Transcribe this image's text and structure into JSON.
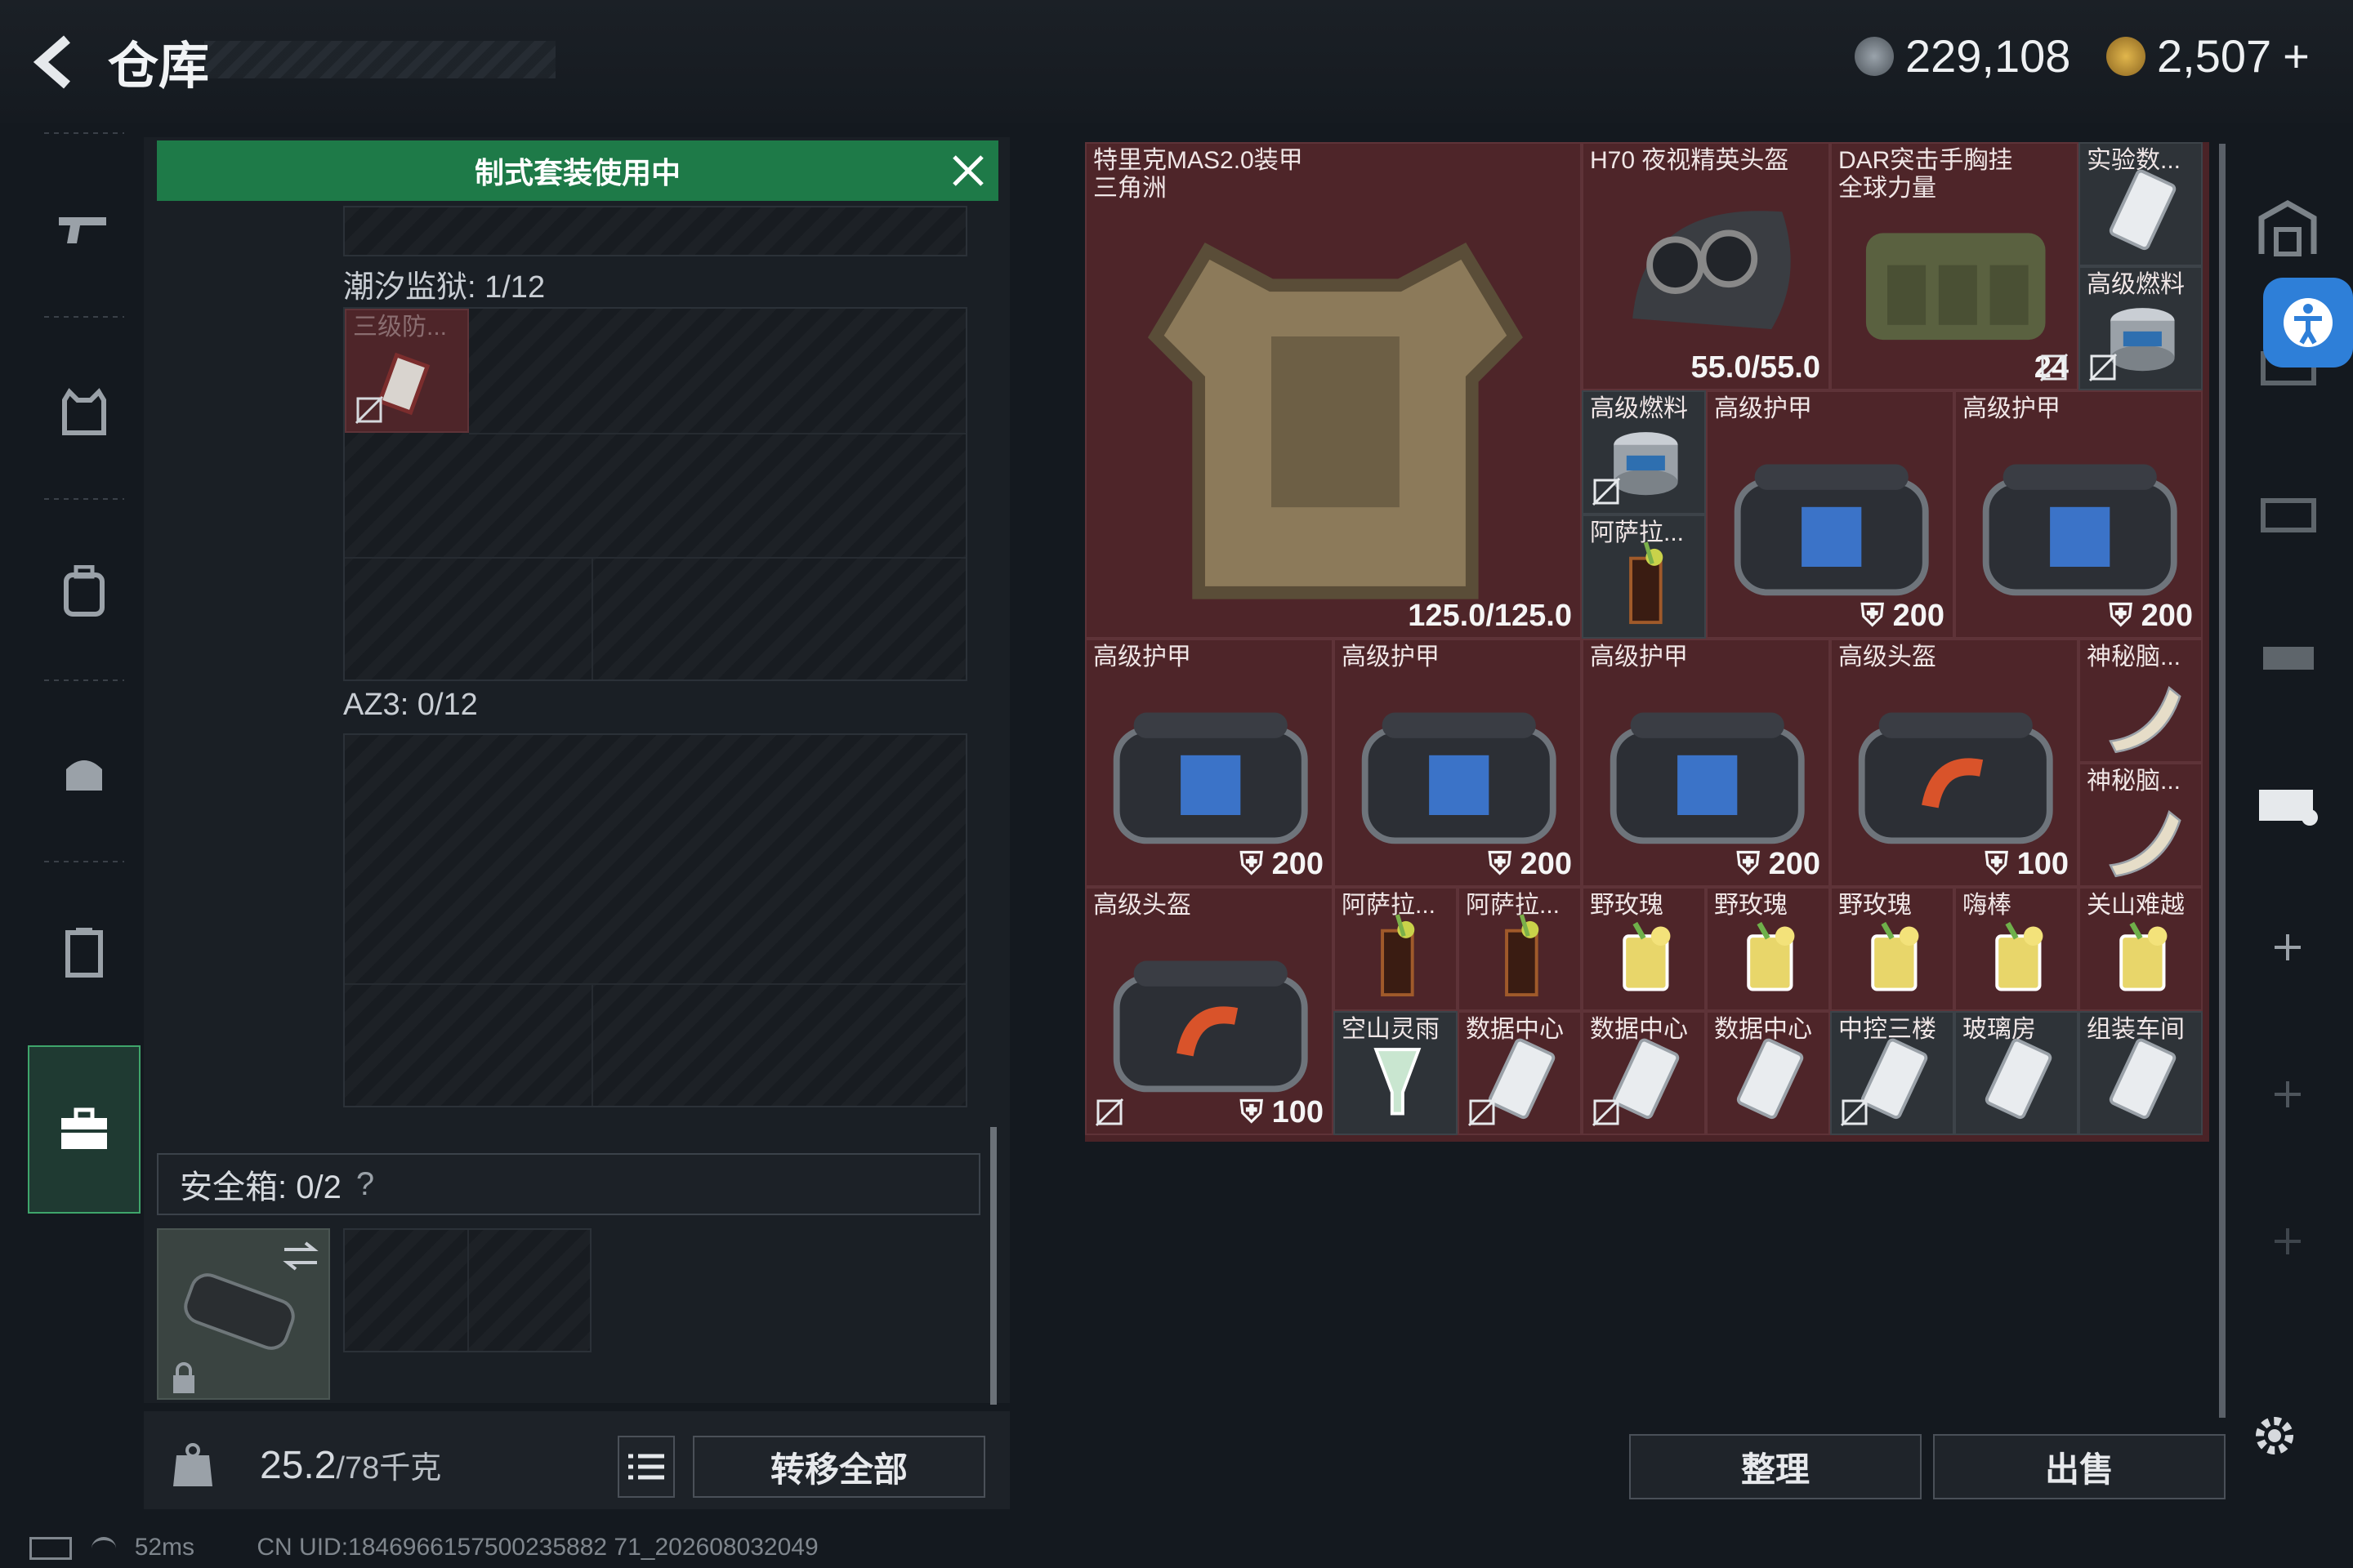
{
  "header": {
    "title": "仓库",
    "currency1": "229,108",
    "currency2": "2,507",
    "currency2_plus": "+"
  },
  "kit_banner": "制式套装使用中",
  "containers": [
    {
      "label": "潮汐监狱: 1/12",
      "item_name": "三级防..."
    },
    {
      "label": "AZ3: 0/12"
    }
  ],
  "safebox": {
    "label": "安全箱: 0/2",
    "help": "?"
  },
  "weight": {
    "current": "25.2",
    "max": "/78千克"
  },
  "buttons": {
    "transfer_all": "转移全部",
    "sort": "整理",
    "sell": "出售"
  },
  "status": {
    "ping": "52ms",
    "uid": "CN UID:1846966157500235882 71_202608032049"
  },
  "stash_items": [
    {
      "id": "vest",
      "name": "特里克MAS2.0装甲\n三角洲",
      "value": "125.0/125.0",
      "type": "vest"
    },
    {
      "id": "helmet",
      "name": "H70 夜视精英头盔",
      "value": "55.0/55.0",
      "type": "nvg"
    },
    {
      "id": "rig",
      "name": "DAR突击手胸挂\n全球力量",
      "value": "24",
      "type": "rig"
    },
    {
      "id": "lab",
      "name": "实验数...",
      "type": "card"
    },
    {
      "id": "fuel1",
      "name": "高级燃料",
      "type": "can"
    },
    {
      "id": "fuel2",
      "name": "高级燃料",
      "type": "can"
    },
    {
      "id": "drink1",
      "name": "阿萨拉...",
      "type": "drink"
    },
    {
      "id": "armor1",
      "name": "高级护甲",
      "value": "200",
      "type": "bag"
    },
    {
      "id": "armor2",
      "name": "高级护甲",
      "value": "200",
      "type": "bag"
    },
    {
      "id": "armor3",
      "name": "高级护甲",
      "value": "200",
      "type": "bag"
    },
    {
      "id": "armor4",
      "name": "高级护甲",
      "value": "200",
      "type": "bag"
    },
    {
      "id": "armor5",
      "name": "高级护甲",
      "value": "200",
      "type": "bag"
    },
    {
      "id": "helm1",
      "name": "高级头盔",
      "value": "100",
      "type": "bagred"
    },
    {
      "id": "mystery1",
      "name": "神秘脑...",
      "type": "horn"
    },
    {
      "id": "mystery2",
      "name": "神秘脑...",
      "type": "horn"
    },
    {
      "id": "helm2",
      "name": "高级头盔",
      "value": "100",
      "type": "bagred"
    },
    {
      "id": "d1",
      "name": "阿萨拉...",
      "type": "drink"
    },
    {
      "id": "d2",
      "name": "阿萨拉...",
      "type": "drink"
    },
    {
      "id": "d3",
      "name": "野玫瑰",
      "type": "cocktail"
    },
    {
      "id": "d4",
      "name": "野玫瑰",
      "type": "cocktail"
    },
    {
      "id": "d5",
      "name": "野玫瑰",
      "type": "cocktail"
    },
    {
      "id": "d6",
      "name": "嗨棒",
      "type": "cocktail"
    },
    {
      "id": "d7",
      "name": "关山难越",
      "type": "cocktail"
    },
    {
      "id": "d8",
      "name": "空山灵雨",
      "type": "glass"
    },
    {
      "id": "c1",
      "name": "数据中心",
      "type": "card"
    },
    {
      "id": "c2",
      "name": "数据中心",
      "type": "card"
    },
    {
      "id": "c3",
      "name": "数据中心",
      "type": "card"
    },
    {
      "id": "c4",
      "name": "中控三楼",
      "type": "card"
    },
    {
      "id": "c5",
      "name": "玻璃房",
      "type": "card"
    },
    {
      "id": "c6",
      "name": "组装车间",
      "type": "card"
    }
  ],
  "colors": {
    "accent_green": "#1e7a48",
    "stash_bg": "#4a2327",
    "blue_btn": "#2e7fd8"
  }
}
